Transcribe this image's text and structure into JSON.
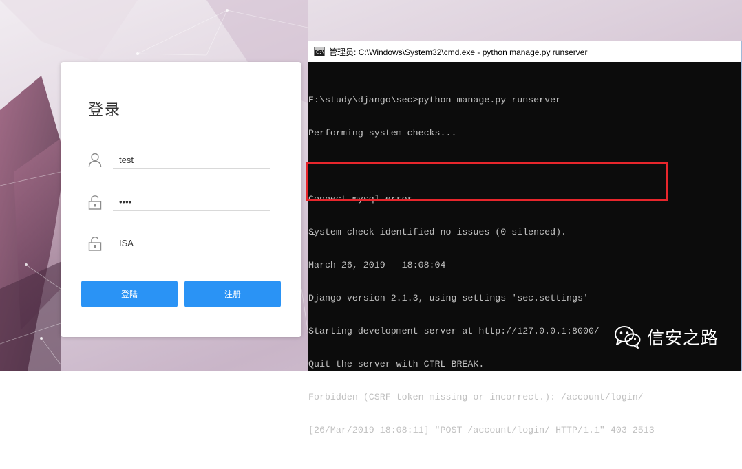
{
  "login": {
    "title": "登录",
    "username_value": "test",
    "password_value": "••••",
    "code_value": "ISA",
    "login_button": "登陆",
    "register_button": "注册"
  },
  "cmd": {
    "title": "管理员: C:\\Windows\\System32\\cmd.exe - python  manage.py runserver",
    "icon_text": "C:\\",
    "lines": [
      "E:\\study\\django\\sec>python manage.py runserver",
      "Performing system checks...",
      "",
      "Connect mysql error.",
      "System check identified no issues (0 silenced).",
      "March 26, 2019 - 18:08:04",
      "Django version 2.1.3, using settings 'sec.settings'",
      "Starting development server at http://127.0.0.1:8000/",
      "Quit the server with CTRL-BREAK.",
      "Forbidden (CSRF token missing or incorrect.): /account/login/",
      "[26/Mar/2019 18:08:11] \"POST /account/login/ HTTP/1.1\" 403 2513"
    ]
  },
  "watermark": {
    "text": "信安之路",
    "icon": "wechat-icon"
  },
  "colors": {
    "primary_button": "#2a93f5",
    "highlight_border": "#e8262c",
    "console_bg": "#0c0c0c",
    "console_text": "#c0c0c0"
  }
}
